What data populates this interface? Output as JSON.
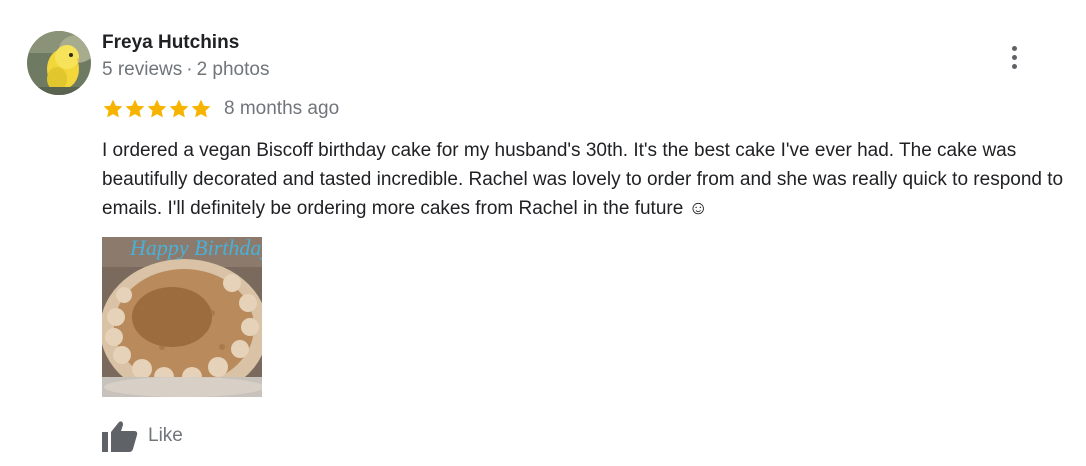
{
  "review": {
    "author": {
      "name": "Freya Hutchins",
      "reviews_count": "5 reviews",
      "separator": "·",
      "photos_count": "2 photos",
      "avatar_icon": "budgie-avatar"
    },
    "rating": {
      "stars": 5,
      "max_stars": 5,
      "star_color": "#f6b400",
      "relative_date": "8 months ago"
    },
    "text": "I ordered a vegan Biscoff birthday cake for my husband's 30th. It's the best cake I've ever had. The cake was beautifully decorated and tasted incredible. Rachel was lovely to order from and she was really quick to respond to emails. I'll definitely be ordering more cakes from Rachel in the future ☺",
    "photo": {
      "icon": "cake-photo",
      "topper_text": "Happy Birthday"
    },
    "actions": {
      "more_icon": "more-vert-icon",
      "like_label": "Like",
      "like_icon": "thumb-up-icon"
    },
    "colors": {
      "text": "#202124",
      "secondary_text": "#70757a",
      "icon": "#5f6368"
    }
  }
}
